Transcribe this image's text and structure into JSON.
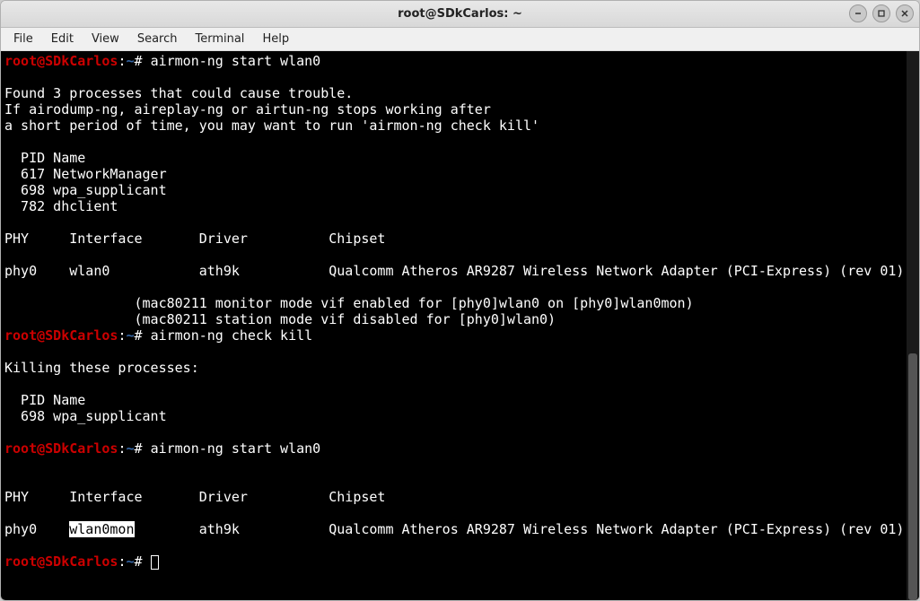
{
  "window": {
    "title": "root@SDkCarlos: ~"
  },
  "menubar": {
    "items": [
      "File",
      "Edit",
      "View",
      "Search",
      "Terminal",
      "Help"
    ]
  },
  "prompt": {
    "user": "root@SDkCarlos",
    "sep1": ":",
    "path": "~",
    "sep2": "#"
  },
  "commands": {
    "c1": "airmon-ng start wlan0",
    "c2": "airmon-ng check kill",
    "c3": "airmon-ng start wlan0"
  },
  "out": {
    "block1": "Found 3 processes that could cause trouble.\nIf airodump-ng, aireplay-ng or airtun-ng stops working after\na short period of time, you may want to run 'airmon-ng check kill'\n\n  PID Name\n  617 NetworkManager\n  698 wpa_supplicant\n  782 dhclient\n\nPHY     Interface       Driver          Chipset\n\nphy0    wlan0           ath9k           Qualcomm Atheros AR9287 Wireless Network Adapter (PCI-Express) (rev 01)\n\n                (mac80211 monitor mode vif enabled for [phy0]wlan0 on [phy0]wlan0mon)\n                (mac80211 station mode vif disabled for [phy0]wlan0)",
    "block2": "Killing these processes:\n\n  PID Name\n  698 wpa_supplicant",
    "block3_header": "PHY     Interface       Driver          Chipset",
    "block3_pre": "phy0    ",
    "block3_hl": "wlan0mon",
    "block3_post": "        ath9k           Qualcomm Atheros AR9287 Wireless Network Adapter (PCI-Express) (rev 01)"
  }
}
